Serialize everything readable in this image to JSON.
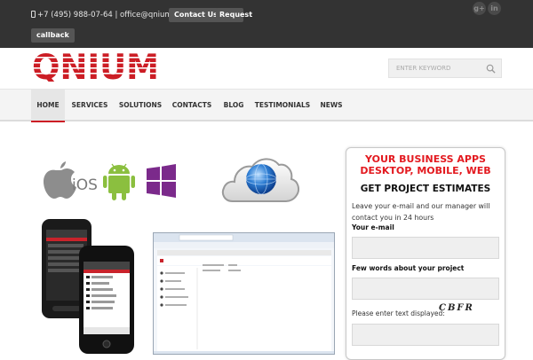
{
  "topbar": {
    "contact_text": "+7 (495) 988-07-64 | office@qnium.com",
    "contact_button": "Contact Us",
    "request_button_line1": "Request",
    "request_button_line2": "callback",
    "social": [
      {
        "icon": "google-plus-icon",
        "glyph": "g+"
      },
      {
        "icon": "linkedin-icon",
        "glyph": "in"
      }
    ]
  },
  "header": {
    "logo_text": "QNIUM",
    "search_placeholder": "ENTER KEYWORD"
  },
  "nav": {
    "items": [
      {
        "label": "HOME",
        "active": true
      },
      {
        "label": "SERVICES"
      },
      {
        "label": "SOLUTIONS"
      },
      {
        "label": "CONTACTS"
      },
      {
        "label": "BLOG"
      },
      {
        "label": "TESTIMONIALS"
      },
      {
        "label": "NEWS"
      }
    ]
  },
  "graphics": {
    "platform_icons": [
      "apple-icon",
      "android-icon",
      "windows-icon"
    ],
    "ios_label": "iOS",
    "cloud_icon": "cloud-globe-icon"
  },
  "form": {
    "headline_line1": "YOUR BUSINESS APPS",
    "headline_line2": "DESKTOP, MOBILE, WEB",
    "title": "GET PROJECT ESTIMATES",
    "description": "Leave your e-mail and our manager will contact you in 24 hours",
    "email_label": "Your e-mail",
    "project_label": "Few words about your project",
    "captcha_label": "Please enter text displayed:",
    "captcha_text": "CBFR"
  },
  "colors": {
    "brand_red": "#cc1d25",
    "topbar_bg": "#333333",
    "nav_bg": "#f4f4f4"
  }
}
